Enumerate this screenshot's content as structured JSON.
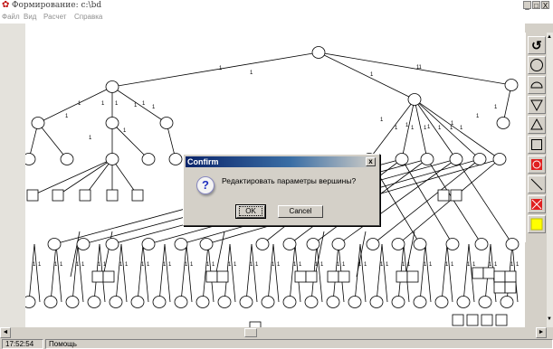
{
  "window": {
    "title": "Формирование: c:\\bd",
    "minimize": "_",
    "maximize": "□",
    "close": "X"
  },
  "menu": [
    {
      "label": "Файл"
    },
    {
      "label": "Вид"
    },
    {
      "label": "Расчет"
    },
    {
      "label": "Справка"
    }
  ],
  "tree": {
    "edge_label": "1"
  },
  "toolbar": [
    {
      "name": "refresh",
      "icon": "circular-arrows-icon",
      "glyph": "↺"
    },
    {
      "name": "circle",
      "icon": "circle-icon"
    },
    {
      "name": "semicircle",
      "icon": "semicircle-icon"
    },
    {
      "name": "triangle-down",
      "icon": "triangle-down-icon"
    },
    {
      "name": "triangle-up",
      "icon": "triangle-up-icon"
    },
    {
      "name": "square",
      "icon": "square-icon"
    },
    {
      "name": "red-circle",
      "icon": "red-circle-icon",
      "color": "#e02020"
    },
    {
      "name": "line",
      "icon": "diagonal-line-icon"
    },
    {
      "name": "delete",
      "icon": "red-cross-icon",
      "color": "#e02020"
    },
    {
      "name": "yellow",
      "icon": "yellow-square-icon",
      "color": "#ffff00"
    }
  ],
  "dialog": {
    "title": "Confirm",
    "close": "x",
    "icon": "?",
    "message": "Редактировать параметры вершины?",
    "ok": "OK",
    "cancel": "Cancel"
  },
  "hscroll": {
    "left": "◄",
    "right": "►"
  },
  "vscroll": {
    "up": "▲",
    "down": "▼"
  },
  "status": {
    "time": "17:52:54",
    "help": "Помощь"
  }
}
